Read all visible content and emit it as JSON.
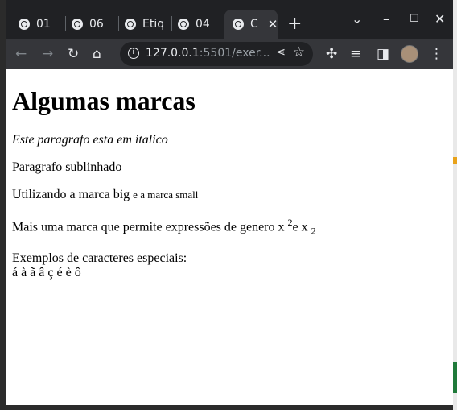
{
  "tabs": [
    {
      "label": "01"
    },
    {
      "label": "06"
    },
    {
      "label": "Etiq"
    },
    {
      "label": "04"
    },
    {
      "label": "C",
      "active": true
    }
  ],
  "toolbar": {
    "url_host": "127.0.0.1",
    "url_rest": ":5501/exer..."
  },
  "page": {
    "title": "Algumas marcas",
    "p_italic": "Este paragrafo esta em italico",
    "p_underline": "Paragrafo sublinhado",
    "p_bigsmall_prefix": "Utilizando a marca big",
    "p_bigsmall_small": "e a marca small",
    "p_exp_prefix": "Mais uma marca que permite expressões de genero x",
    "p_exp_sup": "2",
    "p_exp_mid": "e x",
    "p_exp_sub": "2",
    "special_label": "Exemplos de caracteres especiais:",
    "special_chars": "á à ã â ç é è ô"
  },
  "colors": {
    "tabstrip": "#202124",
    "toolbar": "#35363a"
  }
}
